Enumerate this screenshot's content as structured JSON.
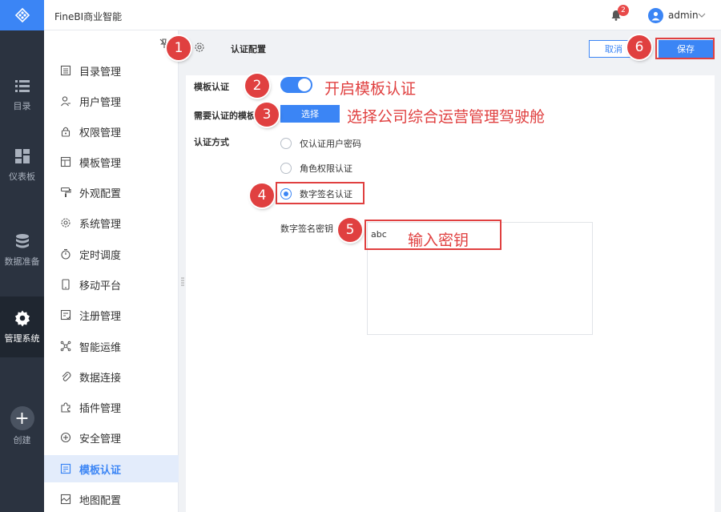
{
  "header": {
    "app_title": "FineBI商业智能",
    "notification_count": "2",
    "user_name": "admin"
  },
  "rail": {
    "items": [
      {
        "label": "目录",
        "icon": "list-icon"
      },
      {
        "label": "仪表板",
        "icon": "dashboard-icon"
      },
      {
        "label": "数据准备",
        "icon": "database-icon"
      },
      {
        "label": "管理系统",
        "icon": "gear-icon",
        "active": true
      },
      {
        "label": "创建",
        "icon": "plus-icon"
      }
    ]
  },
  "sidebar": {
    "items": [
      {
        "label": "目录管理",
        "icon": "catalog-icon"
      },
      {
        "label": "用户管理",
        "icon": "user-icon"
      },
      {
        "label": "权限管理",
        "icon": "lock-icon"
      },
      {
        "label": "模板管理",
        "icon": "template-icon"
      },
      {
        "label": "外观配置",
        "icon": "paint-icon"
      },
      {
        "label": "系统管理",
        "icon": "settings-icon"
      },
      {
        "label": "定时调度",
        "icon": "timer-icon"
      },
      {
        "label": "移动平台",
        "icon": "mobile-icon"
      },
      {
        "label": "注册管理",
        "icon": "register-icon"
      },
      {
        "label": "智能运维",
        "icon": "network-icon"
      },
      {
        "label": "数据连接",
        "icon": "link-icon"
      },
      {
        "label": "插件管理",
        "icon": "plugin-icon"
      },
      {
        "label": "安全管理",
        "icon": "shield-icon"
      },
      {
        "label": "模板认证",
        "icon": "certificate-icon",
        "active": true
      },
      {
        "label": "地图配置",
        "icon": "map-icon"
      }
    ]
  },
  "content": {
    "title": "认证配置",
    "cancel_label": "取消",
    "save_label": "保存",
    "template_auth_label": "模板认证",
    "template_auth_enabled": true,
    "templates_label": "需要认证的模板",
    "choose_label": "选择",
    "auth_method_label": "认证方式",
    "auth_methods": [
      "仅认证用户密码",
      "角色权限认证",
      "数字签名认证"
    ],
    "selected_method": "数字签名认证",
    "key_label": "数字签名密钥",
    "key_value": "abc"
  },
  "annotations": {
    "steps": [
      "1",
      "2",
      "3",
      "4",
      "5",
      "6"
    ],
    "step2_text": "开启模板认证",
    "step3_text": "选择公司综合运营管理驾驶舱",
    "step5_text": "输入密钥",
    "color": "#e04040"
  },
  "colors": {
    "accent": "#3b85f5",
    "rail_bg": "#2b3340",
    "annotation": "#e04040"
  }
}
